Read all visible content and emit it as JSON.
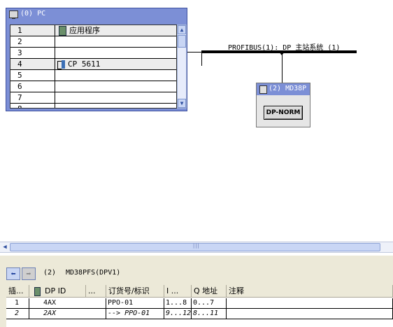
{
  "station": {
    "title": "(0) PC",
    "slots": [
      {
        "num": "1",
        "module": "应用程序",
        "icon": "application-icon"
      },
      {
        "num": "2",
        "module": ""
      },
      {
        "num": "3",
        "module": ""
      },
      {
        "num": "4",
        "module": "CP 5611",
        "icon": "cp-network-card-icon"
      },
      {
        "num": "5",
        "module": ""
      },
      {
        "num": "6",
        "module": ""
      },
      {
        "num": "7",
        "module": ""
      },
      {
        "num": "8",
        "module": ""
      }
    ]
  },
  "bus": {
    "label": "PROFIBUS(1): DP 主站系统 (1)"
  },
  "slave": {
    "title": "(2) MD38P",
    "button": "DP-NORM"
  },
  "detail": {
    "slave_number": "(2)",
    "slave_name": "MD38PFS(DPV1)",
    "columns": [
      "插...",
      "DP ID",
      "...",
      "订货号/标识",
      "I ...",
      "Q 地址",
      "注释"
    ],
    "rows": [
      {
        "slot": "1",
        "dp_id": "4AX",
        "order": "PPO-01",
        "i_addr": "1...8",
        "q_addr": "0...7",
        "comment": "",
        "italic": false
      },
      {
        "slot": "2",
        "dp_id": "2AX",
        "order": "--> PPO-01",
        "i_addr": "9...12",
        "q_addr": "8...11",
        "comment": "",
        "italic": true
      }
    ]
  },
  "colors": {
    "titlebar": "#7c8fd6",
    "panel": "#ece9d8",
    "scroll": "#c9d6f5"
  }
}
